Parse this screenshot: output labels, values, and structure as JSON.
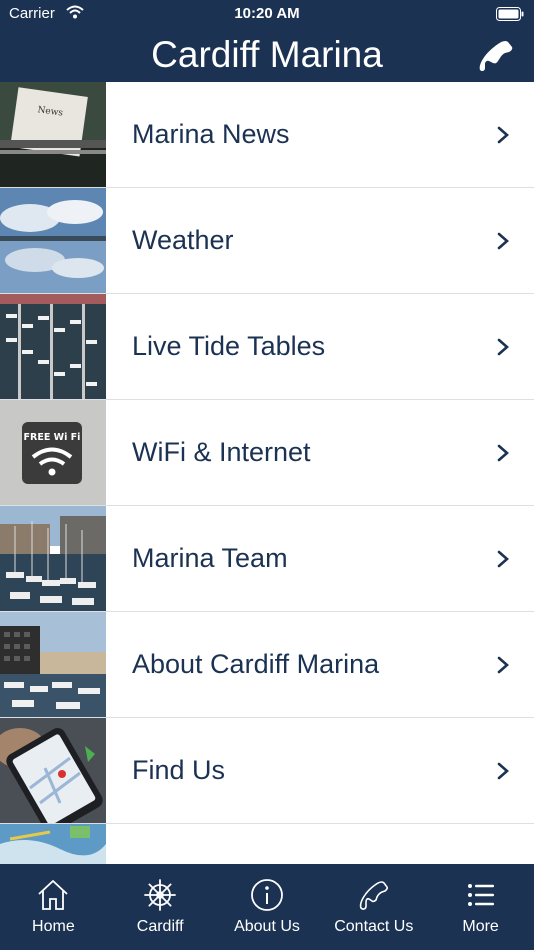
{
  "status_bar": {
    "carrier": "Carrier",
    "time": "10:20 AM"
  },
  "header": {
    "title": "Cardiff Marina",
    "call_icon": "phone-icon"
  },
  "menu": [
    {
      "label": "Marina News",
      "thumb": "typewriter-news-photo"
    },
    {
      "label": "Weather",
      "thumb": "sky-reflection-photo"
    },
    {
      "label": "Live Tide Tables",
      "thumb": "marina-aerial-photo"
    },
    {
      "label": "WiFi & Internet",
      "thumb": "free-wifi-sign-photo",
      "thumb_text": "FREE Wi Fi"
    },
    {
      "label": "Marina Team",
      "thumb": "boats-harbour-photo"
    },
    {
      "label": "About Cardiff Marina",
      "thumb": "marina-buildings-photo"
    },
    {
      "label": "Find Us",
      "thumb": "phone-map-photo"
    },
    {
      "label": "",
      "thumb": "map-photo"
    }
  ],
  "tabs": [
    {
      "label": "Home",
      "icon": "home-icon"
    },
    {
      "label": "Cardiff",
      "icon": "ship-wheel-icon"
    },
    {
      "label": "About Us",
      "icon": "info-icon"
    },
    {
      "label": "Contact Us",
      "icon": "phone-icon"
    },
    {
      "label": "More",
      "icon": "more-list-icon"
    }
  ],
  "colors": {
    "navy": "#1b3253",
    "divider": "#dcdfe3",
    "text": "#1b3253"
  }
}
